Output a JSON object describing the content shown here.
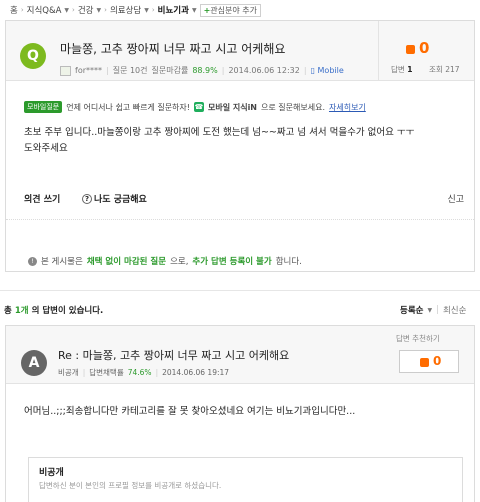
{
  "breadcrumb": {
    "items": [
      "홈",
      "지식Q&A",
      "건강",
      "의료상담",
      "비뇨기과"
    ],
    "favorite_label": "관심분야 추가"
  },
  "question": {
    "avatar_letter": "Q",
    "title": "마늘쫑, 고추 짱아찌 너무 짜고 시고 어케해요",
    "author": "for****",
    "answer_count_label": "질문 10건",
    "closing_rate_label": "질문마감률",
    "closing_rate": "88.9%",
    "date": "2014.06.06 12:32",
    "source": "Mobile",
    "likes": "0",
    "answers_label": "답변",
    "answers": "1",
    "views_label": "조회",
    "views": "217",
    "mobile_tag": "모바일질문",
    "notice_text": "언제 어디서나 쉽고 빠르게 질문하자!",
    "app_name": "모바일 지식iN",
    "notice_text2": "으로 질문해보세요.",
    "notice_link": "자세히보기",
    "body_line1": "초보 주부 입니다..마늘쫑이랑 고추 짱아찌에 도전 했는데 넘~~짜고 넘 셔서 먹을수가 없어요 ㅜㅜ",
    "body_line2": "도와주세요",
    "action_comment": "의견 쓰기",
    "action_curious": "나도 궁금해요",
    "action_report": "신고",
    "info_prefix": "본 게시물은",
    "info_highlight1": "채택 없이 마감된 질문",
    "info_mid": "으로,",
    "info_highlight2": "추가 답변 등록이 불가",
    "info_suffix": "합니다."
  },
  "answers_header": {
    "prefix": "총",
    "count": "1개",
    "suffix": "의 답변이 있습니다.",
    "sort_primary": "등록순",
    "sort_secondary": "최신순"
  },
  "answer": {
    "avatar_letter": "A",
    "title": "Re : 마늘쫑, 고추 짱아찌 너무 짜고 시고 어케해요",
    "author": "비공개",
    "adopt_rate_label": "답변채택률",
    "adopt_rate": "74.6%",
    "date": "2014.06.06 19:17",
    "recommend_label": "답변 추천하기",
    "recommend_count": "0",
    "body": "어머님..;;;죄송합니다만 카테고리를 잘 못 찾아오셨네요 여기는 비뇨기과입니다만...",
    "card_title": "비공개",
    "card_sub": "답변하신 분이 본인의 프로필 정보를 비공개로 하셨습니다."
  },
  "colors": {
    "green": "#2c9a2c",
    "orange": "#ff6c00",
    "avatar_q": "#7dba1f",
    "avatar_a": "#666666"
  }
}
